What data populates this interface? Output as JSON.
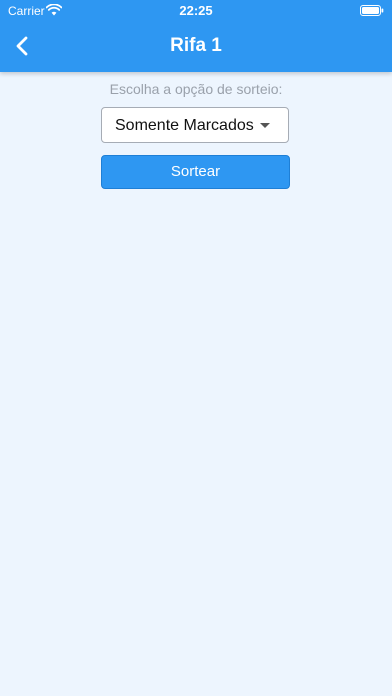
{
  "status_bar": {
    "carrier": "Carrier",
    "time": "22:25",
    "icons": [
      "wifi-icon",
      "battery-icon"
    ]
  },
  "header": {
    "title": "Rifa 1",
    "back_icon": "chevron-left-icon",
    "background_color": "#2e97f2"
  },
  "main": {
    "prompt": "Escolha a opção de sorteio:",
    "draw_option": {
      "selected": "Somente Marcados"
    },
    "draw_button_label": "Sortear"
  },
  "colors": {
    "accent": "#2e97f2",
    "background": "#edf5fe",
    "prompt_text": "#9aa1ab"
  }
}
